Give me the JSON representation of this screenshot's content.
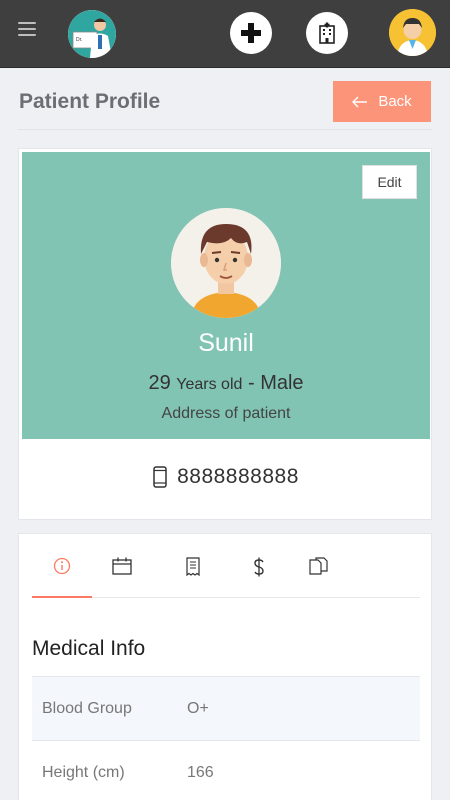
{
  "topbar": {
    "icons": [
      "menu-icon",
      "doctor-logo",
      "add-icon",
      "hospital-icon",
      "user-avatar"
    ],
    "colors": {
      "background": "#3f3f3f",
      "avatar": "#f6c234"
    }
  },
  "header": {
    "title": "Patient Profile",
    "back_label": "Back",
    "colors": {
      "back_button": "#fb9478"
    }
  },
  "profile": {
    "edit_label": "Edit",
    "name": "Sunil",
    "age": "29",
    "age_suffix": "Years old",
    "separator": "-",
    "gender": "Male",
    "address": "Address of patient",
    "phone": "8888888888",
    "colors": {
      "banner": "#82c4b4"
    }
  },
  "tabs": [
    {
      "icon": "info-icon",
      "active": true
    },
    {
      "icon": "calendar-icon",
      "active": false
    },
    {
      "icon": "receipt-icon",
      "active": false
    },
    {
      "icon": "dollar-icon",
      "active": false
    },
    {
      "icon": "documents-icon",
      "active": false
    }
  ],
  "medical_info": {
    "title": "Medical Info",
    "rows": [
      {
        "label": "Blood Group",
        "value": "O+"
      },
      {
        "label": "Height (cm)",
        "value": "166"
      }
    ]
  }
}
